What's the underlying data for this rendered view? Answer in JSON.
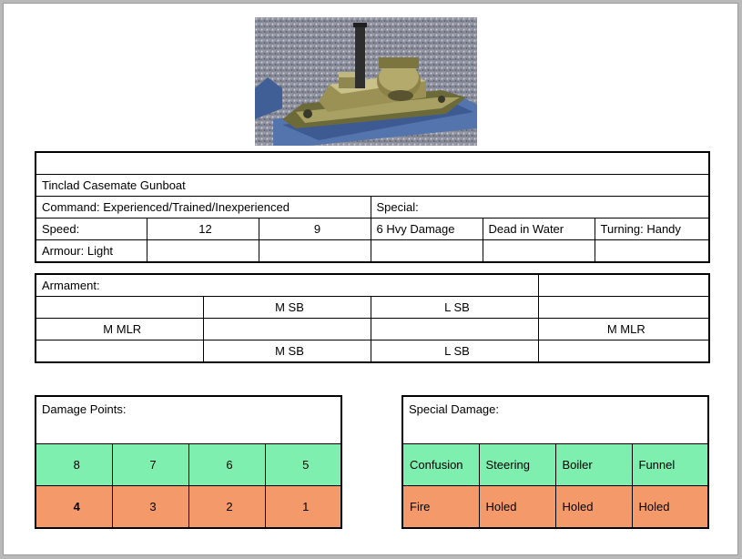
{
  "title": "Tinclad Casemate Gunboat",
  "command": "Command: Experienced/Trained/Inexperienced",
  "special": "Special:",
  "speed": {
    "label": "Speed:",
    "v1": "12",
    "v2": "9"
  },
  "damage_state": {
    "heavy": "6 Hvy Damage",
    "dead": "Dead in Water",
    "turning": "Turning:  Handy"
  },
  "armour": "Armour: Light",
  "armament": {
    "label": "Armament:",
    "row1": [
      "M SB",
      "L SB"
    ],
    "row2": [
      "M MLR",
      "M MLR"
    ],
    "row3": [
      "M SB",
      "L SB"
    ]
  },
  "damage_points": {
    "label": "Damage Points:",
    "top": [
      "8",
      "7",
      "6",
      "5"
    ],
    "bottom": [
      "4",
      "3",
      "2",
      "1"
    ]
  },
  "special_damage": {
    "label": "Special Damage:",
    "top": [
      "Confusion",
      "Steering",
      "Boiler",
      "Funnel"
    ],
    "bottom": [
      "Fire",
      "Holed",
      "Holed",
      "Holed"
    ]
  },
  "colors": {
    "green": "#7fefb0",
    "orange": "#f49a6a"
  }
}
